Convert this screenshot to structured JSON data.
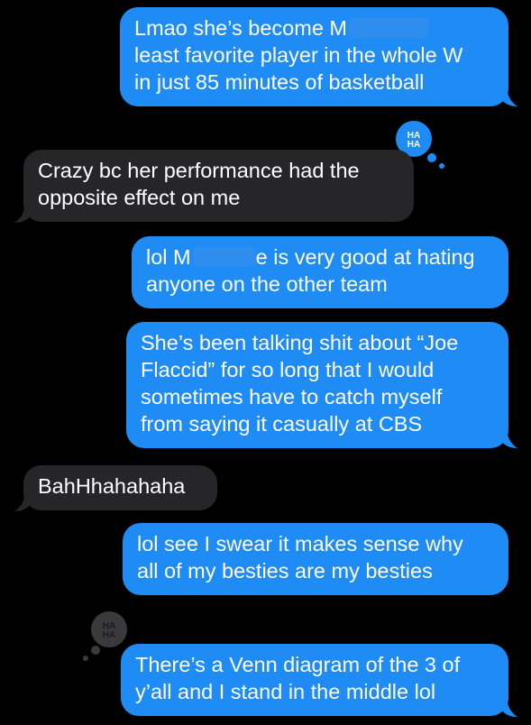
{
  "messages": [
    {
      "id": "m1",
      "dir": "sent",
      "lines": [
        "Lmao she’s become M",
        "least favorite player in the whole W",
        "in just 85 minutes of basketball"
      ]
    },
    {
      "id": "m2",
      "dir": "received",
      "lines": [
        "Crazy bc her performance had the",
        "opposite effect on me"
      ],
      "tapback": "haha"
    },
    {
      "id": "m3",
      "dir": "sent",
      "lines": [
        "lol M",
        "e is very good at hating",
        "anyone on the other team"
      ]
    },
    {
      "id": "m4",
      "dir": "sent",
      "lines": [
        "She’s been talking shit about “Joe",
        "Flaccid” for so long that I would",
        "sometimes have to catch myself",
        "from saying it casually at CBS"
      ]
    },
    {
      "id": "m5",
      "dir": "received",
      "lines": [
        "BahHhahahaha"
      ]
    },
    {
      "id": "m6",
      "dir": "sent",
      "lines": [
        "lol see I swear it makes sense why",
        "all of my besties are my besties"
      ]
    },
    {
      "id": "m7",
      "dir": "sent",
      "lines": [
        "There’s a Venn diagram of the 3 of",
        "y’all and I stand in the middle lol"
      ],
      "tapback": "haha"
    }
  ],
  "tapback_icon": "haha-icon",
  "colors": {
    "sent": "#1f8bf4",
    "received": "#262628",
    "background": "#000000",
    "tapback_sent": "#1f8bf4",
    "tapback_received": "#3a3a3c"
  }
}
